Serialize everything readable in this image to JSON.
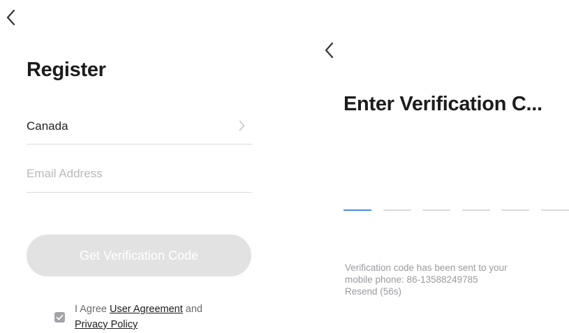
{
  "register": {
    "back_icon": "chevron-left-icon",
    "title": "Register",
    "country": "Canada",
    "country_chevron_icon": "chevron-right-icon",
    "email_placeholder": "Email Address",
    "email_value": "",
    "get_code_label": "Get Verification Code",
    "agree": {
      "checked": true,
      "prefix": "I Agree ",
      "user_agreement": "User Agreement",
      "and": " and",
      "privacy_policy": "Privacy Policy"
    }
  },
  "verify": {
    "back_icon": "chevron-left-icon",
    "title": "Enter Verification C...",
    "code_length": 6,
    "message_line1": "Verification code has been sent to your",
    "message_line2": "mobile phone: 86-13588249785",
    "resend": "Resend (56s)",
    "accent_color": "#4a8fe0"
  }
}
